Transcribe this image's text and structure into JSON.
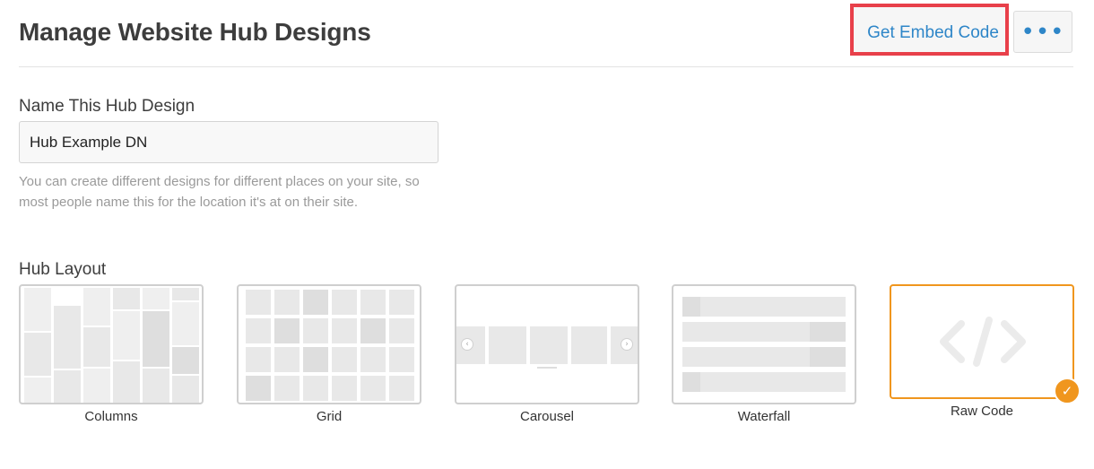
{
  "header": {
    "title": "Manage Website Hub Designs",
    "embed_button_label": "Get Embed Code",
    "more_button_label": "•••"
  },
  "form": {
    "name_label": "Name This Hub Design",
    "name_value": "Hub Example DN",
    "helper_text": "You can create different designs for different places on your site, so most people name this for the location it's at on their site."
  },
  "layout": {
    "label": "Hub Layout",
    "options": [
      {
        "label": "Columns",
        "selected": false
      },
      {
        "label": "Grid",
        "selected": false
      },
      {
        "label": "Carousel",
        "selected": false
      },
      {
        "label": "Waterfall",
        "selected": false
      },
      {
        "label": "Raw Code",
        "selected": true
      }
    ],
    "check_glyph": "✓"
  },
  "colors": {
    "accent_blue": "#2e86c8",
    "highlight_red": "#e8404a",
    "selected_orange": "#f0961e"
  }
}
